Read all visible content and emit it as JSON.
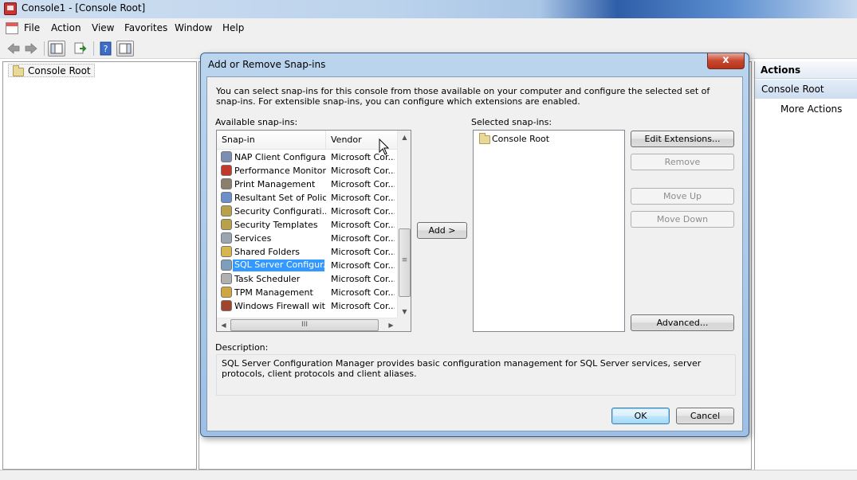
{
  "window": {
    "title": "Console1 - [Console Root]"
  },
  "menubar": {
    "items": [
      "File",
      "Action",
      "View",
      "Favorites",
      "Window",
      "Help"
    ]
  },
  "tree": {
    "root_label": "Console Root"
  },
  "actions_pane": {
    "header": "Actions",
    "section": "Console Root",
    "more_actions": "More Actions"
  },
  "dialog": {
    "title": "Add or Remove Snap-ins",
    "close_glyph": "x",
    "intro": "You can select snap-ins for this console from those available on your computer and configure the selected set of snap-ins. For extensible snap-ins, you can configure which extensions are enabled.",
    "available_label": "Available snap-ins:",
    "selected_label": "Selected snap-ins:",
    "columns": [
      "Snap-in",
      "Vendor"
    ],
    "snapins": [
      {
        "name": "NAP Client Configura...",
        "vendor": "Microsoft Cor...",
        "icon": "nap-icon",
        "color": "#7a8fb3"
      },
      {
        "name": "Performance Monitor",
        "vendor": "Microsoft Cor...",
        "icon": "perf-monitor-icon",
        "color": "#c0392b"
      },
      {
        "name": "Print Management",
        "vendor": "Microsoft Cor...",
        "icon": "printer-icon",
        "color": "#8a7f6a"
      },
      {
        "name": "Resultant Set of Policy",
        "vendor": "Microsoft Cor...",
        "icon": "policy-icon",
        "color": "#6b8fc9"
      },
      {
        "name": "Security Configurati...",
        "vendor": "Microsoft Cor...",
        "icon": "security-config-icon",
        "color": "#b8a14a"
      },
      {
        "name": "Security Templates",
        "vendor": "Microsoft Cor...",
        "icon": "security-templates-icon",
        "color": "#b8a14a"
      },
      {
        "name": "Services",
        "vendor": "Microsoft Cor...",
        "icon": "gear-icon",
        "color": "#9aa5b1"
      },
      {
        "name": "Shared Folders",
        "vendor": "Microsoft Cor...",
        "icon": "shared-folder-icon",
        "color": "#d9b64d"
      },
      {
        "name": "SQL Server Configur...",
        "vendor": "Microsoft Cor...",
        "icon": "sql-server-icon",
        "color": "#7d9fbd",
        "selected": true
      },
      {
        "name": "Task Scheduler",
        "vendor": "Microsoft Cor...",
        "icon": "clock-icon",
        "color": "#b0b0b0"
      },
      {
        "name": "TPM Management",
        "vendor": "Microsoft Cor...",
        "icon": "key-icon",
        "color": "#d0a640"
      },
      {
        "name": "Windows Firewall wit...",
        "vendor": "Microsoft Cor...",
        "icon": "firewall-icon",
        "color": "#a0442e"
      }
    ],
    "selected_items": [
      "Console Root"
    ],
    "buttons": {
      "add": "Add >",
      "edit_extensions": "Edit Extensions...",
      "remove": "Remove",
      "move_up": "Move Up",
      "move_down": "Move Down",
      "advanced": "Advanced...",
      "ok": "OK",
      "cancel": "Cancel"
    },
    "description_label": "Description:",
    "description": "SQL Server Configuration Manager provides basic configuration management for SQL Server services, server protocols, client protocols and client aliases.",
    "scroll_glyphs": {
      "up": "▲",
      "down": "▼",
      "left": "◀",
      "right": "▶",
      "grip_v": "≡",
      "grip_h": "III"
    }
  }
}
